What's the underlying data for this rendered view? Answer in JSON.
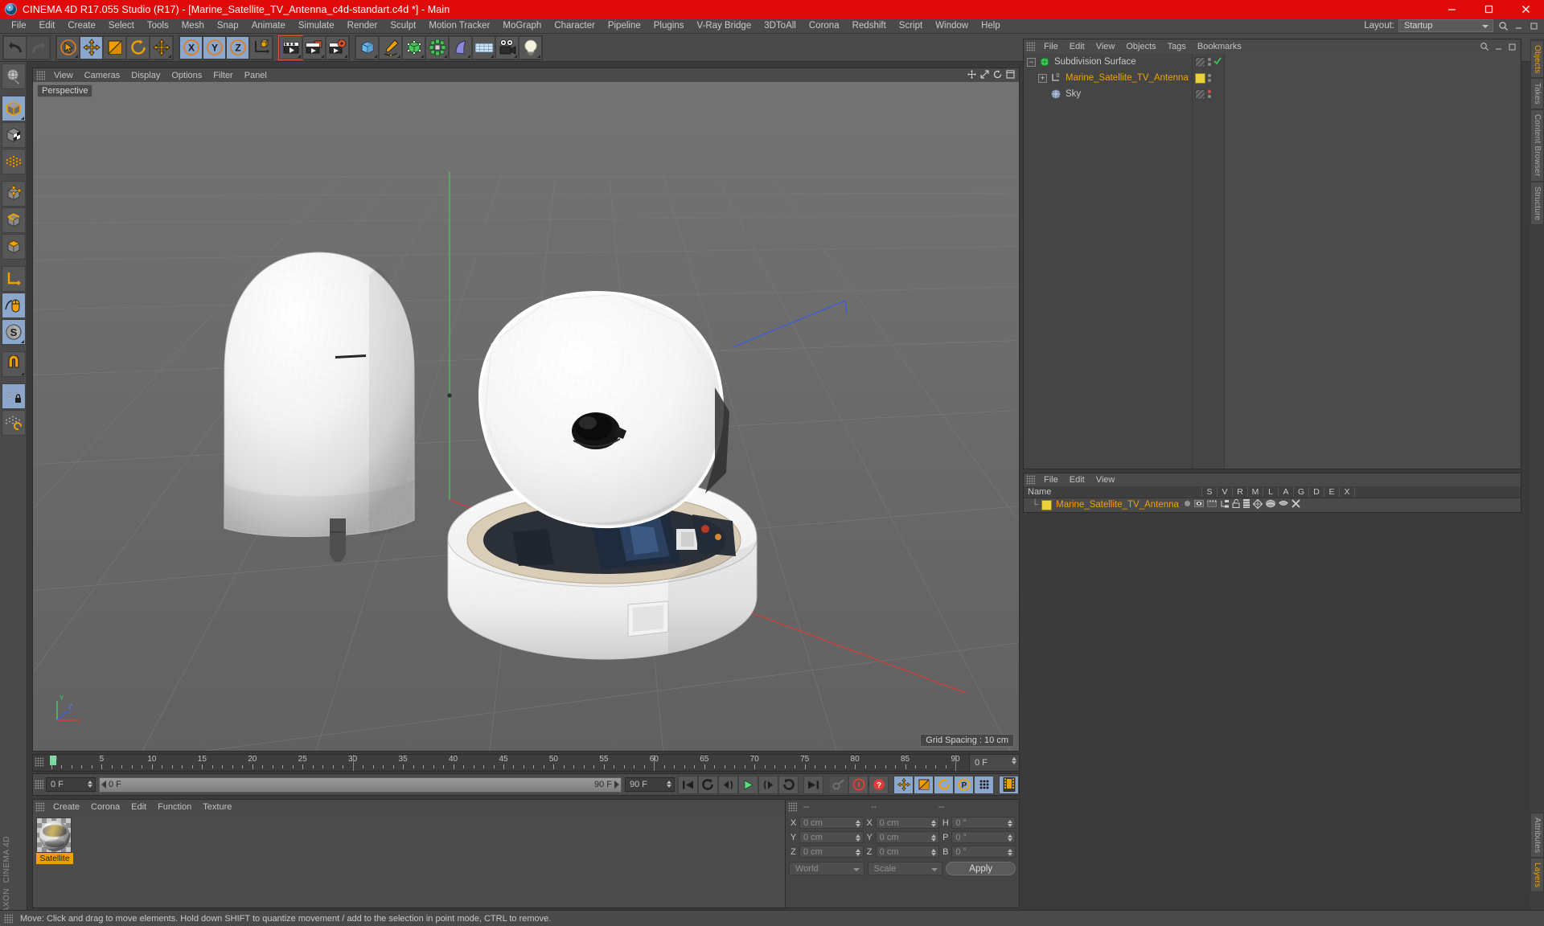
{
  "window": {
    "title": "CINEMA 4D R17.055 Studio (R17) - [Marine_Satellite_TV_Antenna_c4d-standart.c4d *] - Main",
    "minimize_label": "–",
    "maximize_label": "❐",
    "close_label": "✕",
    "titlebar_color": "#e00a0a"
  },
  "menubar": {
    "items": [
      "File",
      "Edit",
      "Create",
      "Select",
      "Tools",
      "Mesh",
      "Snap",
      "Animate",
      "Simulate",
      "Render",
      "Sculpt",
      "Motion Tracker",
      "MoGraph",
      "Character",
      "Pipeline",
      "Plugins",
      "V-Ray Bridge",
      "3DToAll",
      "Corona",
      "Redshift",
      "Script",
      "Window",
      "Help"
    ],
    "layout_label": "Layout:",
    "layout_value": "Startup",
    "search_icon": "search-icon"
  },
  "toolbar_top": {
    "groups": [
      {
        "buttons": [
          {
            "name": "undo-button",
            "icon": "undo-arrow-icon",
            "active": false
          },
          {
            "name": "redo-button",
            "icon": "redo-arrow-icon",
            "active": false,
            "disabled": true
          }
        ]
      },
      {
        "buttons": [
          {
            "name": "live-selection-tool",
            "icon": "cursor-circle-icon",
            "active": false
          },
          {
            "name": "move-tool",
            "icon": "move-arrows-icon",
            "active": true
          },
          {
            "name": "scale-tool",
            "icon": "scale-box-icon",
            "active": false
          },
          {
            "name": "rotate-tool",
            "icon": "rotate-circle-icon",
            "active": false
          },
          {
            "name": "move-tool-duplicate",
            "icon": "move-arrows-icon",
            "active": false
          }
        ]
      },
      {
        "buttons": [
          {
            "name": "lock-x-axis",
            "icon": "x-axis-icon",
            "label": "X",
            "active": true
          },
          {
            "name": "lock-y-axis",
            "icon": "y-axis-icon",
            "label": "Y",
            "active": true
          },
          {
            "name": "lock-z-axis",
            "icon": "z-axis-icon",
            "label": "Z",
            "active": true
          },
          {
            "name": "world-object-coordinates",
            "icon": "world-axis-cube-icon",
            "active": false
          }
        ]
      },
      {
        "buttons": [
          {
            "name": "render-view",
            "icon": "clapperboard-icon",
            "active": false
          },
          {
            "name": "render-to-picture-viewer",
            "icon": "clapperboard-window-icon",
            "active": false
          },
          {
            "name": "render-settings",
            "icon": "clapperboard-gear-icon",
            "active": false
          }
        ]
      },
      {
        "buttons": [
          {
            "name": "add-cube-object",
            "icon": "cube-icon",
            "active": false
          },
          {
            "name": "add-spline",
            "icon": "pen-spline-icon",
            "active": false
          },
          {
            "name": "add-generator",
            "icon": "green-cube-generator-icon",
            "active": false
          },
          {
            "name": "add-modelling-object",
            "icon": "array-green-icon",
            "active": false
          },
          {
            "name": "add-deformer",
            "icon": "bend-deformer-icon",
            "active": false
          },
          {
            "name": "add-environment",
            "icon": "floor-grid-icon",
            "active": false
          },
          {
            "name": "add-camera",
            "icon": "camera-icon",
            "active": false
          },
          {
            "name": "add-light",
            "icon": "light-bulb-icon",
            "active": false
          }
        ]
      }
    ]
  },
  "toolbar_left": {
    "buttons": [
      {
        "name": "make-editable-tool",
        "icon": "globe-wrench-icon",
        "active": false
      },
      {
        "name": "model-mode",
        "icon": "cube-orange-outline-icon",
        "active": true
      },
      {
        "name": "texture-mode",
        "icon": "checker-cube-icon",
        "active": false
      },
      {
        "name": "deformed-points-mode",
        "icon": "orange-lattice-icon",
        "active": false
      },
      {
        "name": "points-mode",
        "icon": "cube-points-icon",
        "active": false
      },
      {
        "name": "edges-mode",
        "icon": "cube-edges-icon",
        "active": false
      },
      {
        "name": "polygons-mode",
        "icon": "cube-polygons-icon",
        "active": false
      },
      {
        "name": "object-axis-mode",
        "icon": "axis-arrow-icon",
        "active": false
      },
      {
        "name": "viewport-solo-mode",
        "icon": "mouse-orange-icon",
        "active": true
      },
      {
        "name": "snap-settings",
        "icon": "s-circle-icon",
        "active": true
      },
      {
        "name": "magnet-tool",
        "icon": "magnet-icon",
        "active": false
      },
      {
        "name": "lock-workplane",
        "icon": "grid-lock-icon",
        "active": true
      },
      {
        "name": "workplane-mode",
        "icon": "grid-orange-icon",
        "active": false
      }
    ],
    "brand_top": "MAXON",
    "brand_bottom": "CINEMA 4D"
  },
  "viewport": {
    "menu_items": [
      "View",
      "Cameras",
      "Display",
      "Options",
      "Filter",
      "Panel"
    ],
    "label": "Perspective",
    "grid_spacing": "Grid Spacing : 10 cm",
    "nav_icons": [
      "move-view-icon",
      "scale-view-icon",
      "rotate-view-icon",
      "maximize-view-icon"
    ],
    "axis_labels": {
      "y": "Y",
      "x": "X",
      "z": "Z"
    }
  },
  "object_manager": {
    "menu_items": [
      "File",
      "Edit",
      "View",
      "Objects",
      "Tags",
      "Bookmarks"
    ],
    "rows": [
      {
        "name": "Subdivision Surface",
        "icon": "subdivision-surface-icon",
        "depth": 0,
        "expander": "−",
        "tag_stripe": true,
        "tag_yellow": false,
        "check": true,
        "dot_red": false,
        "selected": false
      },
      {
        "name": "Marine_Satellite_TV_Antenna",
        "icon": "null-object-icon",
        "depth": 1,
        "expander": "+",
        "tag_stripe": false,
        "tag_yellow": true,
        "check": false,
        "dot_red": false,
        "selected": true
      },
      {
        "name": "Sky",
        "icon": "sky-sphere-icon",
        "depth": 1,
        "expander": "",
        "tag_stripe": true,
        "tag_yellow": false,
        "check": false,
        "dot_red": true,
        "selected": false
      }
    ]
  },
  "tag_manager": {
    "menu_items": [
      "File",
      "Edit",
      "View"
    ],
    "columns": [
      "Name",
      "S",
      "V",
      "R",
      "M",
      "L",
      "A",
      "G",
      "D",
      "E",
      "X"
    ],
    "rows": [
      {
        "name": "Marine_Satellite_TV_Antenna",
        "swatch": "#e8d43a",
        "icons": [
          "gray-dot-icon",
          "visibility-eye-icon",
          "clapperboard-icon",
          "hierarchy-icon",
          "unlock-icon",
          "layers-icon",
          "deform-icon",
          "shade-icon",
          "cap-icon",
          "x-red-icon"
        ]
      }
    ]
  },
  "vertical_tabs": {
    "top": [
      {
        "label": "Objects",
        "selected": true
      },
      {
        "label": "Takes",
        "selected": false
      },
      {
        "label": "Content Browser",
        "selected": false
      },
      {
        "label": "Structure",
        "selected": false
      }
    ],
    "bottom": [
      {
        "label": "Attributes",
        "selected": false
      },
      {
        "label": "Layers",
        "selected": true
      }
    ]
  },
  "timeline": {
    "frame_numbers": [
      0,
      5,
      10,
      15,
      20,
      25,
      30,
      35,
      40,
      45,
      50,
      55,
      60,
      65,
      70,
      75,
      80,
      85,
      90
    ],
    "min_frame": 0,
    "max_frame": 90,
    "current_frame_field": "0 F",
    "current_frame_right": "0 F",
    "range_start": "0 F",
    "range_end": "90 F",
    "end_frame_field": "90 F",
    "end_frame_button": "90 F",
    "playback_buttons": [
      {
        "name": "go-to-start-button",
        "icon": "skip-start-icon",
        "active": false
      },
      {
        "name": "previous-keyframe-button",
        "icon": "prev-key-icon",
        "active": false
      },
      {
        "name": "step-back-button",
        "icon": "step-back-icon",
        "active": false
      },
      {
        "name": "play-button",
        "icon": "play-icon",
        "active": false
      },
      {
        "name": "step-forward-button",
        "icon": "step-forward-icon",
        "active": false
      },
      {
        "name": "next-keyframe-button",
        "icon": "next-key-icon",
        "active": false
      },
      {
        "name": "go-to-end-button",
        "icon": "skip-end-icon",
        "active": false
      }
    ],
    "record_buttons": [
      {
        "name": "autokeying-button",
        "icon": "autokey-icon",
        "active": false
      },
      {
        "name": "record-active-objects-button",
        "icon": "record-red-icon",
        "active": false
      },
      {
        "name": "keyframe-selection-button",
        "icon": "question-red-icon",
        "active": false
      }
    ],
    "key_toggle_buttons": [
      {
        "name": "position-key-toggle",
        "icon": "move-arrows-icon",
        "active": true
      },
      {
        "name": "scale-key-toggle",
        "icon": "scale-box-icon",
        "active": true
      },
      {
        "name": "rotation-key-toggle",
        "icon": "rotate-circle-icon",
        "active": true
      },
      {
        "name": "parameter-key-toggle",
        "icon": "p-circle-icon",
        "active": true
      },
      {
        "name": "point-level-animation-toggle",
        "icon": "pla-dots-icon",
        "active": true
      }
    ],
    "timeline_view_button": {
      "name": "timeline-view-button",
      "icon": "filmstrip-icon",
      "active": true
    }
  },
  "material_manager": {
    "menu_items": [
      "Create",
      "Corona",
      "Edit",
      "Function",
      "Texture"
    ],
    "materials": [
      {
        "name": "Satellite",
        "selected": true
      }
    ]
  },
  "coordinates_manager": {
    "header_dashes": [
      "--",
      "--",
      "--"
    ],
    "position": {
      "label_x": "X",
      "label_y": "Y",
      "label_z": "Z",
      "x": "0 cm",
      "y": "0 cm",
      "z": "0 cm"
    },
    "size": {
      "label_x": "X",
      "label_y": "Y",
      "label_z": "Z",
      "x": "0 cm",
      "y": "0 cm",
      "z": "0 cm"
    },
    "rotation": {
      "label_h": "H",
      "label_p": "P",
      "label_b": "B",
      "h": "0 °",
      "p": "0 °",
      "b": "0 °"
    },
    "coord_system": "World",
    "transform_mode": "Scale",
    "apply_label": "Apply"
  },
  "statusbar": {
    "text": "Move: Click and drag to move elements. Hold down SHIFT to quantize movement / add to the selection in point mode, CTRL to remove."
  }
}
